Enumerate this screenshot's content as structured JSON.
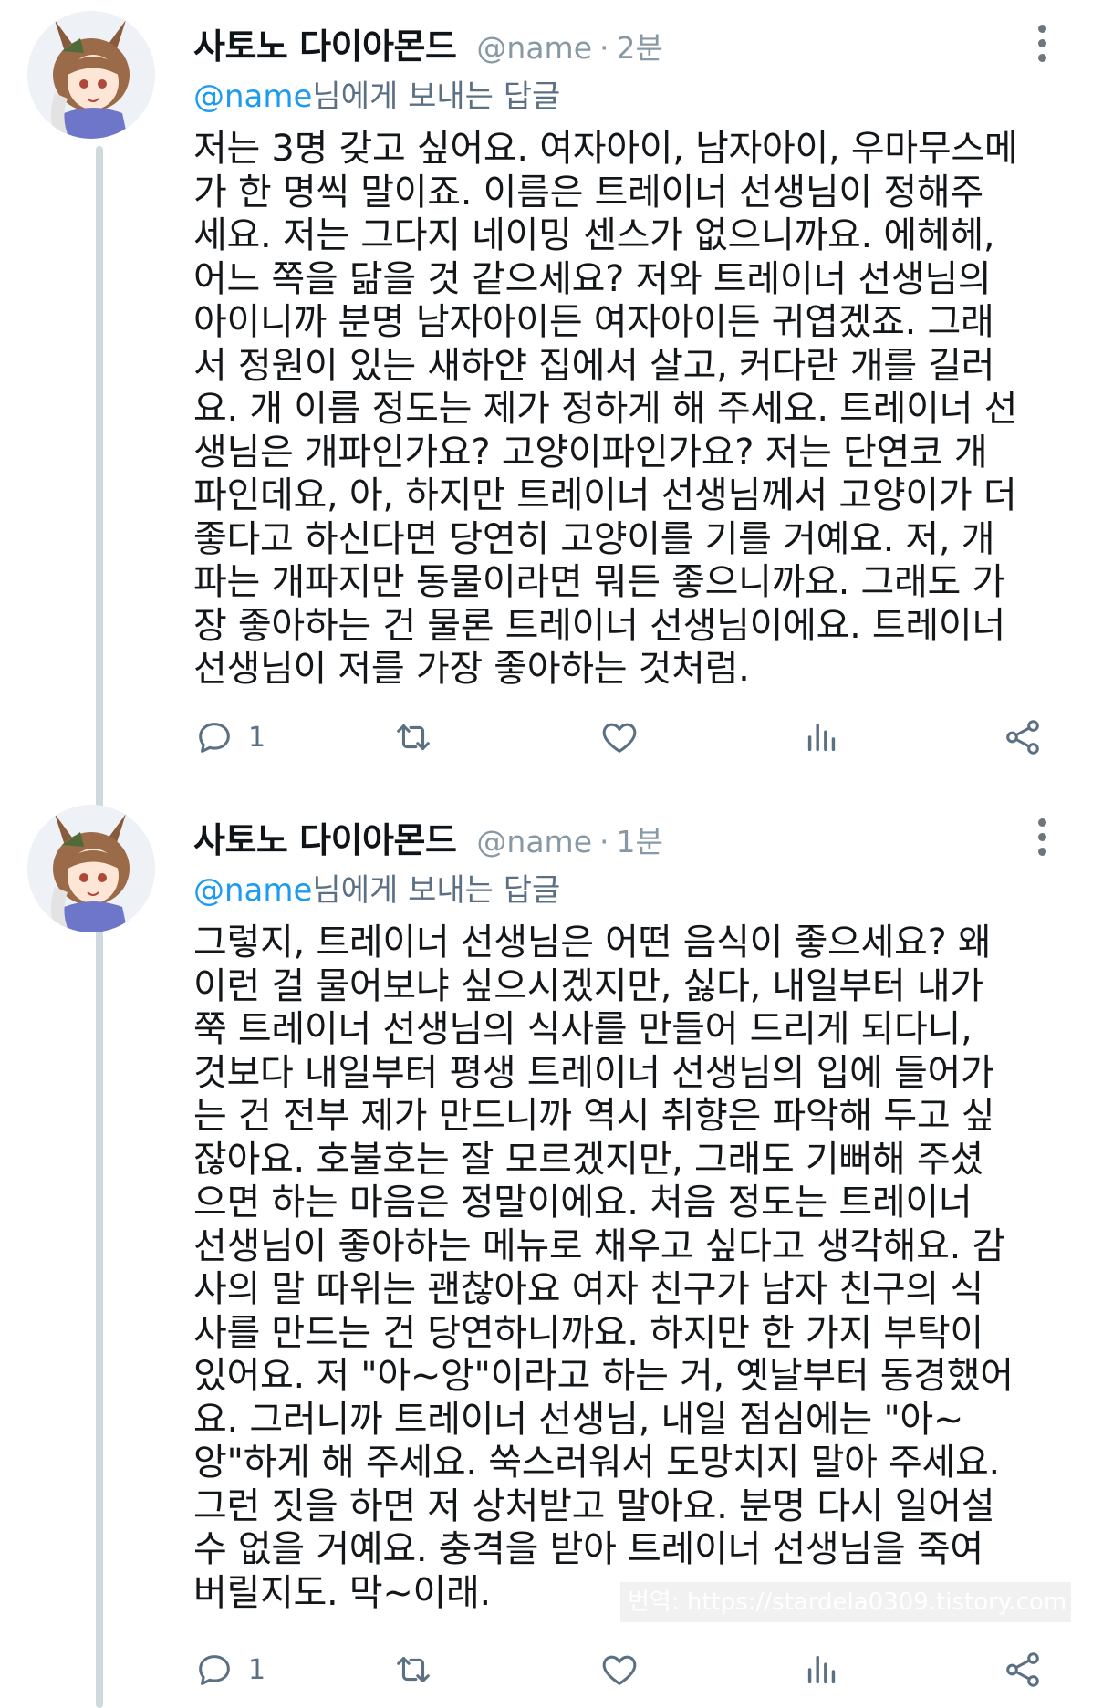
{
  "tweets": [
    {
      "display_name": "사토노 다이아몬드",
      "handle": "@name",
      "separator": "·",
      "time": "2분",
      "reply_handle": "@name",
      "reply_suffix": "님에게 보내는 답글",
      "text": "저는 3명 갖고 싶어요. 여자아이, 남자아이, 우마무스메\n가 한 명씩 말이죠. 이름은 트레이너 선생님이 정해주\n세요. 저는 그다지 네이밍 센스가 없으니까요. 에헤헤,\n어느 쪽을 닮을 것 같으세요? 저와 트레이너 선생님의\n아이니까 분명 남자아이든 여자아이든 귀엽겠죠. 그래\n서 정원이 있는 새하얀 집에서 살고, 커다란 개를 길러\n요. 개 이름 정도는 제가 정하게 해 주세요. 트레이너 선\n생님은 개파인가요? 고양이파인가요? 저는 단연코 개\n파인데요, 아, 하지만 트레이너 선생님께서 고양이가 더\n좋다고 하신다면 당연히 고양이를 기를 거예요. 저, 개\n파는 개파지만 동물이라면 뭐든 좋으니까요. 그래도 가\n장 좋아하는 건 물론 트레이너 선생님이에요. 트레이너\n선생님이 저를 가장 좋아하는 것처럼.",
      "reply_count": "1",
      "icons": [
        "more-icon",
        "reply-icon",
        "retweet-icon",
        "like-icon",
        "stats-icon",
        "share-icon"
      ]
    },
    {
      "display_name": "사토노 다이아몬드",
      "handle": "@name",
      "separator": "·",
      "time": "1분",
      "reply_handle": "@name",
      "reply_suffix": "님에게 보내는 답글",
      "text": "그렇지, 트레이너 선생님은 어떤 음식이 좋으세요? 왜\n이런 걸 물어보냐 싶으시겠지만, 싫다, 내일부터 내가\n쭉 트레이너 선생님의 식사를 만들어 드리게 되다니,\n것보다 내일부터 평생 트레이너 선생님의 입에 들어가\n는 건 전부 제가 만드니까 역시 취향은 파악해 두고 싶\n잖아요. 호불호는 잘 모르겠지만, 그래도 기뻐해 주셨\n으면 하는 마음은 정말이에요. 처음 정도는 트레이너\n선생님이 좋아하는 메뉴로 채우고 싶다고 생각해요. 감\n사의 말 따위는 괜찮아요 여자 친구가 남자 친구의 식\n사를 만드는 건 당연하니까요. 하지만 한 가지 부탁이\n있어요. 저 \"아~앙\"이라고 하는 거, 옛날부터 동경했어\n요. 그러니까 트레이너 선생님, 내일 점심에는 \"아~\n앙\"하게 해 주세요. 쑥스러워서 도망치지 말아 주세요.\n그런 짓을 하면 저 상처받고 말아요. 분명 다시 일어설\n수 없을 거예요. 충격을 받아 트레이너 선생님을 죽여\n버릴지도. 막~이래.",
      "reply_count": "1",
      "icons": [
        "more-icon",
        "reply-icon",
        "retweet-icon",
        "like-icon",
        "stats-icon",
        "share-icon"
      ]
    }
  ],
  "watermark": "번역: https://stardela0309.tistory.com",
  "colors": {
    "handle": "#8899a6",
    "mention": "#1d9bf0",
    "icon": "#5b7083",
    "thread_line": "#cfd9de"
  }
}
